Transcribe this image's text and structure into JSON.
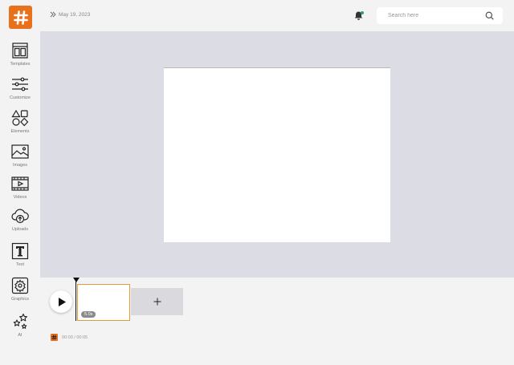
{
  "sidebar": {
    "logo_icon": "hashtag-icon",
    "items": [
      {
        "label": "Templates",
        "icon": "templates-icon"
      },
      {
        "label": "Customize",
        "icon": "sliders-icon"
      },
      {
        "label": "Elements",
        "icon": "shapes-icon"
      },
      {
        "label": "Images",
        "icon": "image-icon"
      },
      {
        "label": "Videos",
        "icon": "video-icon"
      },
      {
        "label": "Uploads",
        "icon": "cloud-upload-icon"
      },
      {
        "label": "Text",
        "icon": "text-icon"
      },
      {
        "label": "Graphics",
        "icon": "graphics-icon"
      },
      {
        "label": "AI",
        "icon": "sparkles-icon"
      }
    ]
  },
  "header": {
    "date": "May 19, 2023",
    "search_placeholder": "Search here"
  },
  "timeline": {
    "clip_duration": "5.0s",
    "time_display": "00:00 / 00:05"
  },
  "colors": {
    "brand": "#e8711c",
    "workspace": "#dcdde4",
    "notification_dot": "#2e9e6b"
  }
}
